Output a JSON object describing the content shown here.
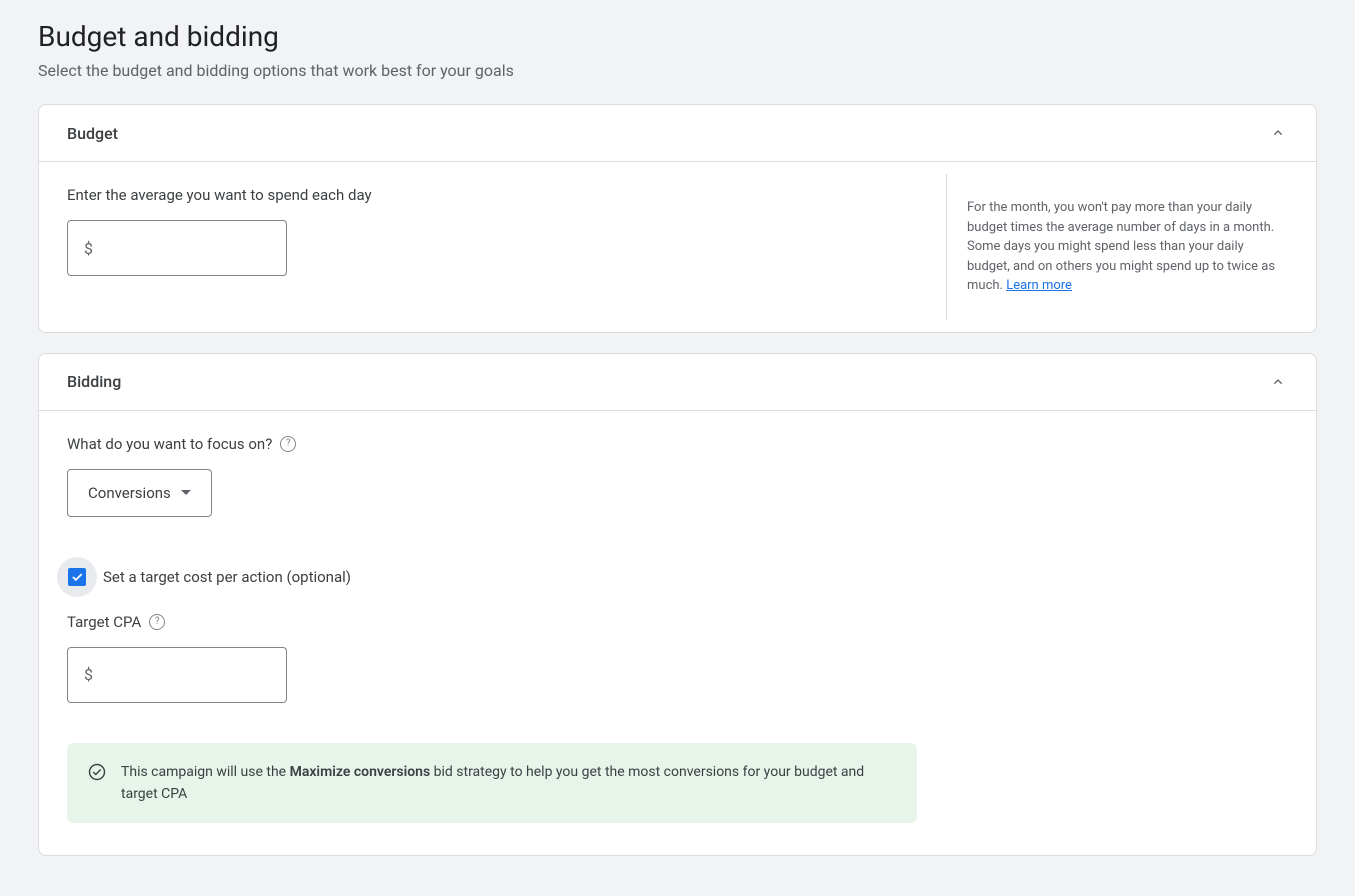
{
  "page": {
    "title": "Budget and bidding",
    "subtitle": "Select the budget and bidding options that work best for your goals"
  },
  "budget": {
    "header": "Budget",
    "label": "Enter the average you want to spend each day",
    "currency_symbol": "$",
    "value": "",
    "side_text": "For the month, you won't pay more than your daily budget times the average number of days in a month. Some days you might spend less than your daily budget, and on others you might spend up to twice as much. ",
    "learn_more": "Learn more"
  },
  "bidding": {
    "header": "Bidding",
    "focus_question": "What do you want to focus on?",
    "focus_selected": "Conversions",
    "target_checkbox_label": "Set a target cost per action (optional)",
    "target_checkbox_checked": true,
    "target_cpa_label": "Target CPA",
    "target_cpa_currency": "$",
    "target_cpa_value": "",
    "banner_prefix": "This campaign will use the ",
    "banner_strong": "Maximize conversions",
    "banner_suffix": " bid strategy to help you get the most conversions for your budget and target CPA"
  }
}
